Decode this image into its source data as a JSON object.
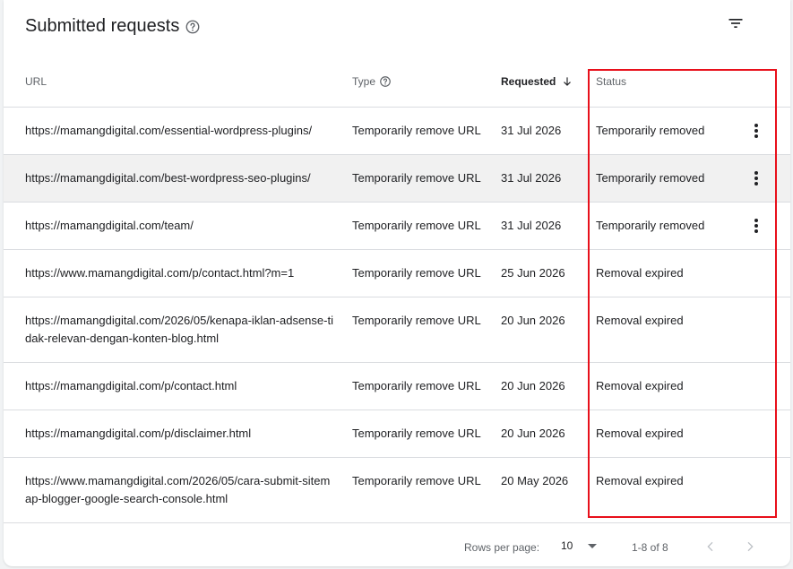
{
  "card": {
    "title": "Submitted requests"
  },
  "table": {
    "headers": {
      "url": "URL",
      "type": "Type",
      "requested": "Requested",
      "status": "Status"
    },
    "rows": [
      {
        "url": "https://mamangdigital.com/essential-wordpress-plugins/",
        "type": "Temporarily remove URL",
        "requested": "31 Jul 2026",
        "status": "Temporarily removed"
      },
      {
        "url": "https://mamangdigital.com/best-wordpress-seo-plugins/",
        "type": "Temporarily remove URL",
        "requested": "31 Jul 2026",
        "status": "Temporarily removed"
      },
      {
        "url": "https://mamangdigital.com/team/",
        "type": "Temporarily remove URL",
        "requested": "31 Jul 2026",
        "status": "Temporarily removed"
      },
      {
        "url": "https://www.mamangdigital.com/p/contact.html?m=1",
        "type": "Temporarily remove URL",
        "requested": "25 Jun 2026",
        "status": "Removal expired"
      },
      {
        "url": "https://mamangdigital.com/2026/05/kenapa-iklan-adsense-tidak-relevan-dengan-konten-blog.html",
        "type": "Temporarily remove URL",
        "requested": "20 Jun 2026",
        "status": "Removal expired"
      },
      {
        "url": "https://mamangdigital.com/p/contact.html",
        "type": "Temporarily remove URL",
        "requested": "20 Jun 2026",
        "status": "Removal expired"
      },
      {
        "url": "https://mamangdigital.com/p/disclaimer.html",
        "type": "Temporarily remove URL",
        "requested": "20 Jun 2026",
        "status": "Removal expired"
      },
      {
        "url": "https://www.mamangdigital.com/2026/05/cara-submit-sitemap-blogger-google-search-console.html",
        "type": "Temporarily remove URL",
        "requested": "20 May 2026",
        "status": "Removal expired"
      }
    ]
  },
  "pagination": {
    "rows_per_page_label": "Rows per page:",
    "rows_per_page_value": "10",
    "range": "1-8 of 8"
  },
  "icons": {
    "help": "help-circle-icon",
    "filter": "filter-icon",
    "sort": "arrow-down-icon",
    "more": "more-vert-icon",
    "caret": "caret-down-icon",
    "prev": "chevron-left-icon",
    "next": "chevron-right-icon"
  },
  "colors": {
    "highlight_border": "#e8101b",
    "hover_row": "#f1f1f1",
    "divider": "#dadce0"
  }
}
